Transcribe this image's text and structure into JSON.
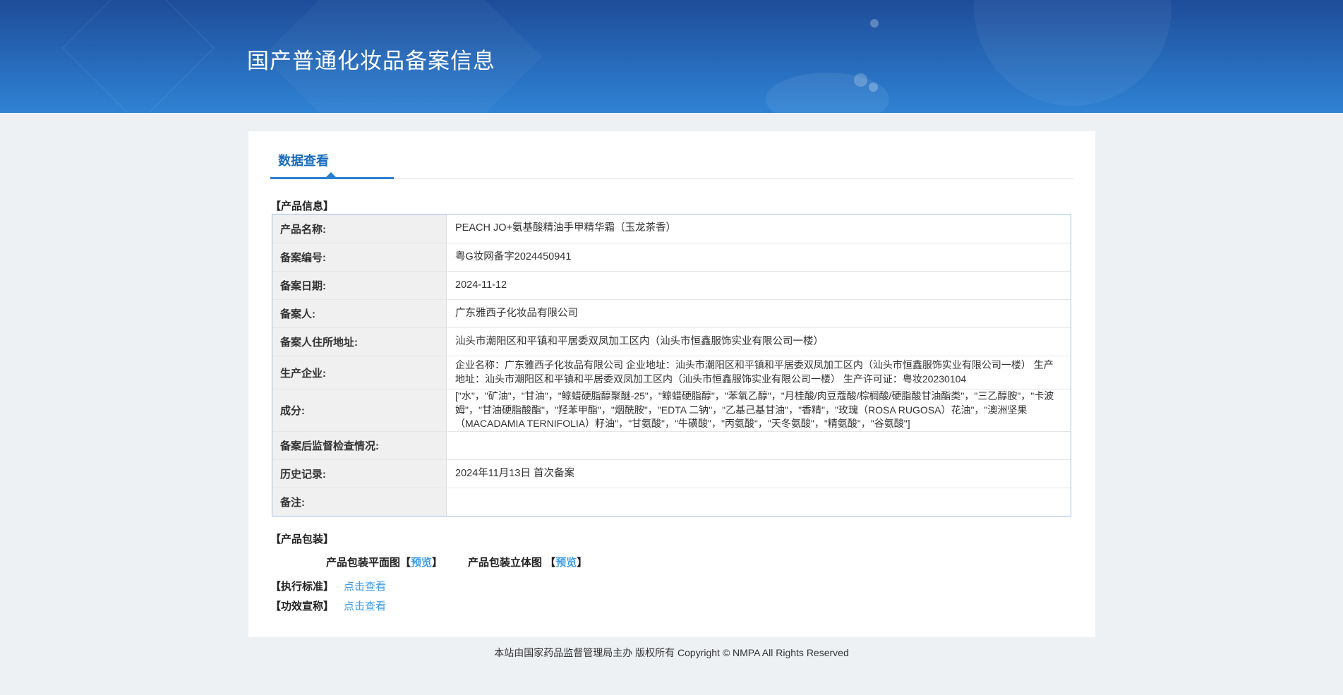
{
  "header": {
    "title": "国产普通化妆品备案信息"
  },
  "tabs": {
    "active": "数据查看"
  },
  "product_info": {
    "section_title": "【产品信息】",
    "rows": [
      {
        "label": "产品名称:",
        "value": "PEACH JO+氨基酸精油手甲精华霜（玉龙茶香）"
      },
      {
        "label": "备案编号:",
        "value": "粤G妆网备字2024450941"
      },
      {
        "label": "备案日期:",
        "value": "2024-11-12"
      },
      {
        "label": "备案人:",
        "value": "广东雅西子化妆品有限公司"
      },
      {
        "label": "备案人住所地址:",
        "value": "汕头市潮阳区和平镇和平居委双凤加工区内（汕头市恒鑫服饰实业有限公司一楼）"
      },
      {
        "label": "生产企业:",
        "value": "企业名称：广东雅西子化妆品有限公司 企业地址：汕头市潮阳区和平镇和平居委双凤加工区内（汕头市恒鑫服饰实业有限公司一楼） 生产地址：汕头市潮阳区和平镇和平居委双凤加工区内（汕头市恒鑫服饰实业有限公司一楼） 生产许可证：粤妆20230104"
      },
      {
        "label": "成分:",
        "value": "[\"水\"，\"矿油\"，\"甘油\"，\"鲸蜡硬脂醇聚醚-25\"，\"鲸蜡硬脂醇\"，\"苯氧乙醇\"，\"月桂酸/肉豆蔻酸/棕榈酸/硬脂酸甘油酯类\"，\"三乙醇胺\"，\"卡波姆\"，\"甘油硬脂酸酯\"，\"羟苯甲酯\"，\"烟酰胺\"，\"EDTA 二钠\"，\"乙基己基甘油\"，\"香精\"，\"玫瑰（ROSA RUGOSA）花油\"，\"澳洲坚果（MACADAMIA TERNIFOLIA）籽油\"，\"甘氨酸\"，\"牛磺酸\"，\"丙氨酸\"，\"天冬氨酸\"，\"精氨酸\"，\"谷氨酸\"]"
      },
      {
        "label": "备案后监督检查情况:",
        "value": ""
      },
      {
        "label": "历史记录:",
        "value": "2024年11月13日 首次备案"
      },
      {
        "label": "备注:",
        "value": ""
      }
    ]
  },
  "packaging": {
    "section_title": "【产品包装】",
    "flat_label": "产品包装平面图",
    "stereo_label": "产品包装立体图 ",
    "bracket_open": "【",
    "preview_label": "预览",
    "bracket_close": "】"
  },
  "standard": {
    "label": "【执行标准】",
    "link": "点击查看"
  },
  "efficacy": {
    "label": "【功效宣称】",
    "link": "点击查看"
  },
  "footer": {
    "copyright": "本站由国家药品监督管理局主办 版权所有 Copyright © NMPA All Rights Reserved"
  },
  "colors": {
    "banner_top": "#1e4c99",
    "banner_bottom": "#2f82d4",
    "tab_blue": "#1a6cbd",
    "accent_underline": "#2b7fd0",
    "link_blue": "#3c9ce8",
    "page_bg": "#eef1f4",
    "label_cell_bg": "#f0f0f0",
    "table_border": "#a3c0e0"
  }
}
